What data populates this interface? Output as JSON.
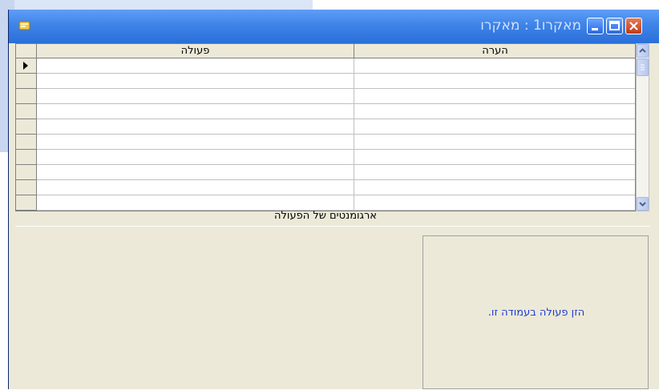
{
  "window": {
    "title": "מאקרו1 : מאקרו",
    "colors": {
      "titlebar": "#3e84e8",
      "body": "#ece9d8",
      "close": "#c23a15",
      "help_text": "#1f3ccf"
    }
  },
  "titlebar_buttons": [
    "close-icon",
    "maximize-icon",
    "minimize-icon"
  ],
  "grid": {
    "columns": [
      "הערה",
      "פעולה"
    ],
    "rows": [
      {
        "selected": true,
        "action": "",
        "comment": ""
      },
      {
        "selected": false,
        "action": "",
        "comment": ""
      },
      {
        "selected": false,
        "action": "",
        "comment": ""
      },
      {
        "selected": false,
        "action": "",
        "comment": ""
      },
      {
        "selected": false,
        "action": "",
        "comment": ""
      },
      {
        "selected": false,
        "action": "",
        "comment": ""
      },
      {
        "selected": false,
        "action": "",
        "comment": ""
      },
      {
        "selected": false,
        "action": "",
        "comment": ""
      },
      {
        "selected": false,
        "action": "",
        "comment": ""
      },
      {
        "selected": false,
        "action": "",
        "comment": ""
      }
    ]
  },
  "arguments_pane": {
    "label": "ארגומנטים של הפעולה",
    "help_text": "הזן פעולה בעמודה זו."
  }
}
